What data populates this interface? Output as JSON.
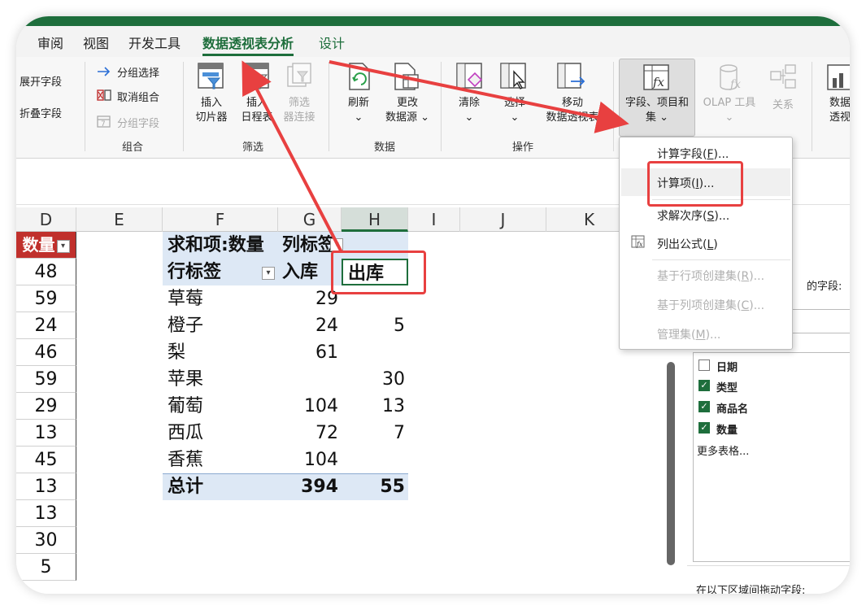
{
  "tabs": [
    "审阅",
    "视图",
    "开发工具",
    "数据透视表分析",
    "设计"
  ],
  "ribbon": {
    "expand_field": "展开字段",
    "collapse_field": "折叠字段",
    "group": {
      "group_selection": "分组选择",
      "ungroup": "取消组合",
      "group_field": "分组字段",
      "label": "组合"
    },
    "filter": {
      "insert_slicer_line1": "插入",
      "insert_slicer_line2": "切片器",
      "insert_timeline_line1": "插入",
      "insert_timeline_line2": "日程表",
      "filter_conn_line1": "筛选",
      "filter_conn_line2": "器连接",
      "label": "筛选"
    },
    "data": {
      "refresh": "刷新",
      "change_line1": "更改",
      "change_line2": "数据源",
      "label": "数据"
    },
    "actions": {
      "clear": "清除",
      "select": "选择",
      "move_line1": "移动",
      "move_line2": "数据透视表",
      "label": "操作"
    },
    "calc": {
      "fields_items_line1": "字段、项目和",
      "fields_items_line2": "集",
      "olap": "OLAP 工具",
      "relations": "关系",
      "pivot_chart_line1": "数据",
      "pivot_chart_line2": "透视"
    }
  },
  "columns": [
    "D",
    "E",
    "F",
    "G",
    "H",
    "I",
    "J",
    "K"
  ],
  "d_column": {
    "header": "数量",
    "values": [
      "48",
      "59",
      "24",
      "46",
      "59",
      "29",
      "13",
      "45",
      "13",
      "13",
      "30",
      "5"
    ]
  },
  "pivot": {
    "title": "求和项:数量",
    "col_label": "列标签",
    "row_label": "行标签",
    "col_in": "入库",
    "col_out": "出库",
    "rows": [
      {
        "name": "草莓",
        "in": "29",
        "out": ""
      },
      {
        "name": "橙子",
        "in": "24",
        "out": "5"
      },
      {
        "name": "梨",
        "in": "61",
        "out": ""
      },
      {
        "name": "苹果",
        "in": "",
        "out": "30"
      },
      {
        "name": "葡萄",
        "in": "104",
        "out": "13"
      },
      {
        "name": "西瓜",
        "in": "72",
        "out": "7"
      },
      {
        "name": "香蕉",
        "in": "104",
        "out": ""
      }
    ],
    "total_label": "总计",
    "total_in": "394",
    "total_out": "55"
  },
  "menu": {
    "items": [
      {
        "label": "计算字段(",
        "key": "F",
        "tail": ")..."
      },
      {
        "label": "计算项(",
        "key": "I",
        "tail": ")..."
      },
      {
        "label": "求解次序(",
        "key": "S",
        "tail": ")..."
      },
      {
        "label": "列出公式(",
        "key": "L",
        "tail": ")"
      },
      {
        "label": "基于行项创建集(",
        "key": "R",
        "tail": ")..."
      },
      {
        "label": "基于列项创建集(",
        "key": "C",
        "tail": ")..."
      },
      {
        "label": "管理集(",
        "key": "M",
        "tail": ")..."
      }
    ]
  },
  "pane": {
    "partial_text": "的字段:",
    "fields": [
      {
        "label": "日期",
        "checked": false
      },
      {
        "label": "类型",
        "checked": true
      },
      {
        "label": "商品名",
        "checked": true
      },
      {
        "label": "数量",
        "checked": true
      }
    ],
    "more_tables": "更多表格...",
    "drag_hint": "在以下区域间拖动字段:"
  },
  "colors": {
    "accent": "#1e6e3c",
    "annotation_red": "#e84040",
    "header_red": "#c0302c"
  }
}
